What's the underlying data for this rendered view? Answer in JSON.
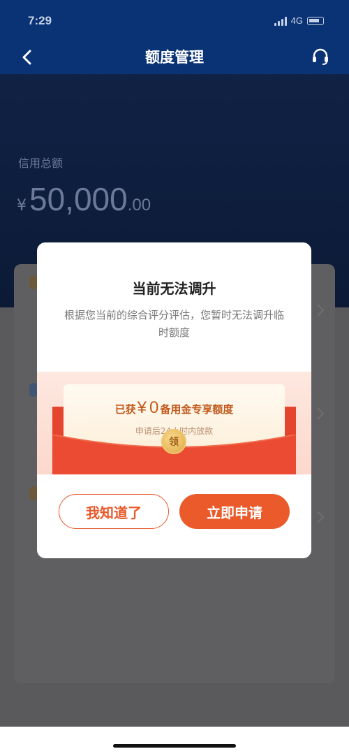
{
  "status_bar": {
    "time": "7:29",
    "network": "4G"
  },
  "nav": {
    "title": "额度管理"
  },
  "credit": {
    "label": "信用总额",
    "currency": "¥",
    "integer": "50,000",
    "decimal": ".00"
  },
  "modal": {
    "title": "当前无法调升",
    "description": "根据您当前的综合评分评估，您暂时无法调升临时额度",
    "envelope": {
      "prefix": "已获",
      "currency": "¥",
      "amount": "0",
      "suffix": "备用金专享额度",
      "subtext": "申请后24小时内放款",
      "seal": "领"
    },
    "buttons": {
      "dismiss": "我知道了",
      "apply": "立即申请"
    }
  },
  "colors": {
    "nav_bg": "#0a3375",
    "accent": "#ea5a2a",
    "envelope_red": "#e4452e"
  }
}
